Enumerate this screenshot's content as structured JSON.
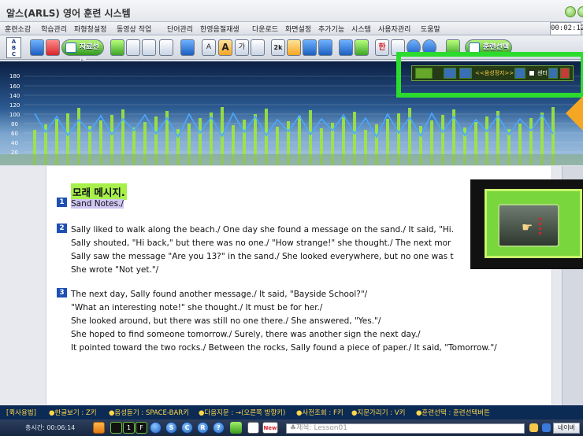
{
  "window": {
    "title": "알스(ARLS) 영어 훈련 시스템"
  },
  "menu": {
    "items": [
      "훈련소감",
      "학습관리",
      "파형청설정",
      "동영상 작업",
      "단어관리",
      "한영음절재생",
      "다운로드",
      "화면설정",
      "추가기능",
      "시스템",
      "사용자관리",
      "도움말"
    ],
    "timer": "00:02:12"
  },
  "toolbar": {
    "abc_letters": [
      "A",
      "B",
      "C"
    ],
    "material_select_label": "자료선택",
    "text_a_small": "A",
    "text_a_big": "A",
    "ga_label": "가",
    "two_k_label": "2k",
    "han_label": "한",
    "training_select_label": "훈련선택"
  },
  "graph": {
    "y_ticks": [
      "180",
      "160",
      "140",
      "120",
      "100",
      "80",
      "60",
      "40",
      "20"
    ],
    "accent": "#9fe83a"
  },
  "floating_control": {
    "audio_mode_label": "<<음성정지>>",
    "center_checkbox_label": "센터",
    "center_checked": false
  },
  "document": {
    "heading": "모래 메시지.",
    "paragraphs": [
      {
        "num": "1",
        "lines": [
          "Sand Notes./"
        ],
        "highlight": true
      },
      {
        "num": "2",
        "lines": [
          "Sally liked to walk along the beach./ One day she found a message on the sand./ It said, \"Hi.",
          "Sally shouted, \"Hi back,\" but there was no one./ \"How strange!\" she thought./ The next mor",
          "Sally saw the message \"Are you 13?\" in the sand./ She looked everywhere, but no one was t",
          "She wrote \"Not yet.\"/"
        ]
      },
      {
        "num": "3",
        "lines": [
          "The next day, Sally found another message./ It said, \"Bayside School?\"/",
          "\"What an interesting note!\" she thought./ It must be for her./",
          "She looked around, but there was still no one there./ She answered, \"Yes.\"/",
          "She hoped to find someone tomorrow./ Surely, there was another sign the next day./",
          "It pointed toward the two rocks./ Between the rocks, Sally found a piece of paper./ It said, \"Tomorrow.\"/"
        ]
      }
    ]
  },
  "hints": [
    "[퀵사용법]",
    "●한글보기 : Z키",
    "●음성듣기 : SPACE-BAR키",
    "●다음지문 : →(오른쪽 방향키)",
    "●사전조회 : F키",
    "●지문가리기 : V키",
    "●훈련선택 : 훈련선택버튼"
  ],
  "status": {
    "time_label": "총시간: 00:06:14",
    "buttons": [
      "1",
      "F",
      "S",
      "C",
      "R",
      "?"
    ],
    "new_badge": "New",
    "lesson_label": "♣제목: Lesson01",
    "naver_label": "네이버"
  }
}
